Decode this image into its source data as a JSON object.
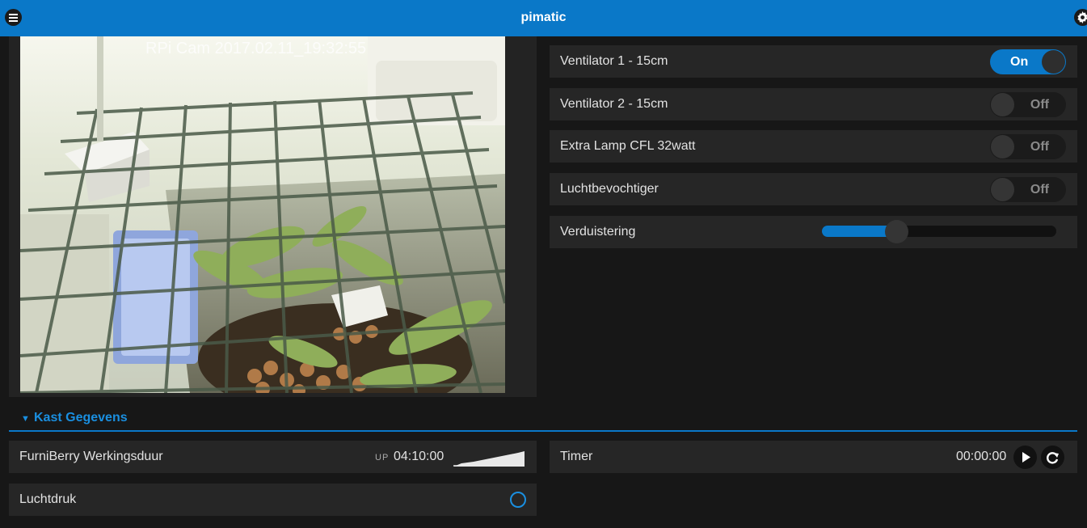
{
  "header": {
    "title": "pimatic",
    "menu_icon": "menu-icon",
    "settings_icon": "gear-icon"
  },
  "camera": {
    "overlay_text": "RPi Cam 2017.02.11_19:32:55"
  },
  "devices": [
    {
      "label": "Ventilator 1 - 15cm",
      "state": "On"
    },
    {
      "label": "Ventilator 2 - 15cm",
      "state": "Off"
    },
    {
      "label": "Extra Lamp CFL 32watt",
      "state": "Off"
    },
    {
      "label": "Luchtbevochtiger",
      "state": "Off"
    }
  ],
  "dimmer": {
    "label": "Verduistering",
    "level": 0.32
  },
  "group": {
    "title": "Kast Gegevens"
  },
  "uptime": {
    "label": "FurniBerry Werkingsduur",
    "prefix": "UP",
    "value": "04:10:00"
  },
  "luchtdruk": {
    "label": "Luchtdruk"
  },
  "timer": {
    "label": "Timer",
    "value": "00:00:00"
  },
  "colors": {
    "accent": "#0a78c8",
    "background": "#171717",
    "panel": "#262626"
  }
}
